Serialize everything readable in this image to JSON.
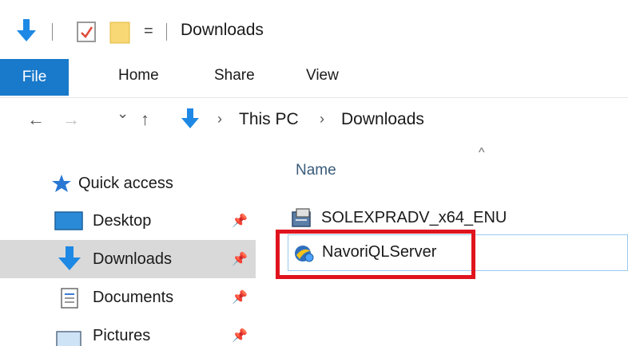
{
  "window": {
    "title": "Downloads",
    "qat_dropdown_glyph": "="
  },
  "ribbon": {
    "tabs": [
      {
        "label": "File",
        "active": true
      },
      {
        "label": "Home"
      },
      {
        "label": "Share"
      },
      {
        "label": "View"
      }
    ]
  },
  "address_bar": {
    "back_glyph": "←",
    "forward_glyph": "→",
    "recent_glyph": "⌄",
    "up_glyph": "↑",
    "crumbs": [
      "This PC",
      "Downloads"
    ],
    "separator": "›"
  },
  "nav_pane": {
    "items": [
      {
        "label": "Quick access",
        "icon": "star-icon"
      },
      {
        "label": "Desktop",
        "icon": "desktop-icon",
        "pinned": true
      },
      {
        "label": "Downloads",
        "icon": "download-arrow-icon",
        "pinned": true,
        "selected": true
      },
      {
        "label": "Documents",
        "icon": "documents-icon",
        "pinned": true
      },
      {
        "label": "Pictures",
        "icon": "pictures-icon",
        "pinned": true
      }
    ],
    "pin_glyph": "📌"
  },
  "content": {
    "column_header": "Name",
    "sort_glyph": "^",
    "files": [
      {
        "name": "SOLEXPRADV_x64_ENU",
        "icon": "installer-icon"
      },
      {
        "name": "NavoriQLServer",
        "icon": "navori-app-icon",
        "focused": true,
        "highlighted": true
      }
    ]
  },
  "colors": {
    "accent": "#1979ca",
    "selection": "#d9d9d9",
    "highlight_box": "#e0141e",
    "header_text": "#3a5b7a"
  }
}
